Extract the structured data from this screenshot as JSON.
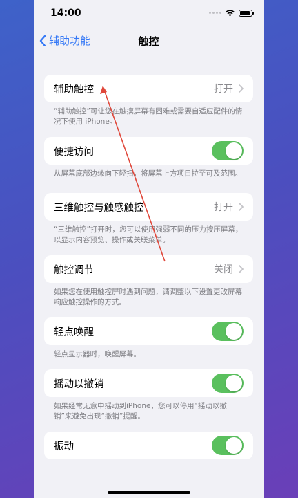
{
  "status_bar": {
    "time": "14:00"
  },
  "nav": {
    "back_label": "辅助功能",
    "title": "触控"
  },
  "sections": [
    {
      "label": "辅助触控",
      "value": "打开",
      "footnote": "“辅助触控”可让您在触摸屏幕有困难或需要自适应配件的情况下使用 iPhone。"
    },
    {
      "label": "便捷访问",
      "footnote": "从屏幕底部边缘向下轻扫，将屏幕上方项目拉至可及范围。"
    },
    {
      "label": "三维触控与触感触控",
      "value": "打开",
      "footnote": "“三维触控”打开时，您可以使用强弱不同的压力按压屏幕，以显示内容预览、操作或关联菜单。"
    },
    {
      "label": "触控调节",
      "value": "关闭",
      "footnote": "如果您在使用触控屏时遇到问题，请调整以下设置更改屏幕响应触控操作的方式。"
    },
    {
      "label": "轻点唤醒",
      "footnote": "轻点显示器时，唤醒屏幕。"
    },
    {
      "label": "摇动以撤销",
      "footnote": "如果经常无意中摇动到iPhone，您可以停用“摇动以撤销”来避免出现“撤销”提醒。"
    },
    {
      "label": "振动"
    }
  ],
  "toggles": {
    "bianjie": 1,
    "qingdian": 1,
    "yaodong": 1,
    "zhendong": 1
  },
  "colors": {
    "accent": "#3478f6",
    "toggle_on": "#5ac05e",
    "annotation": "#e0473a"
  },
  "icons": [
    "chevron-left-icon",
    "chevron-right-icon",
    "wifi-icon",
    "battery-icon",
    "signal-dots-icon"
  ]
}
